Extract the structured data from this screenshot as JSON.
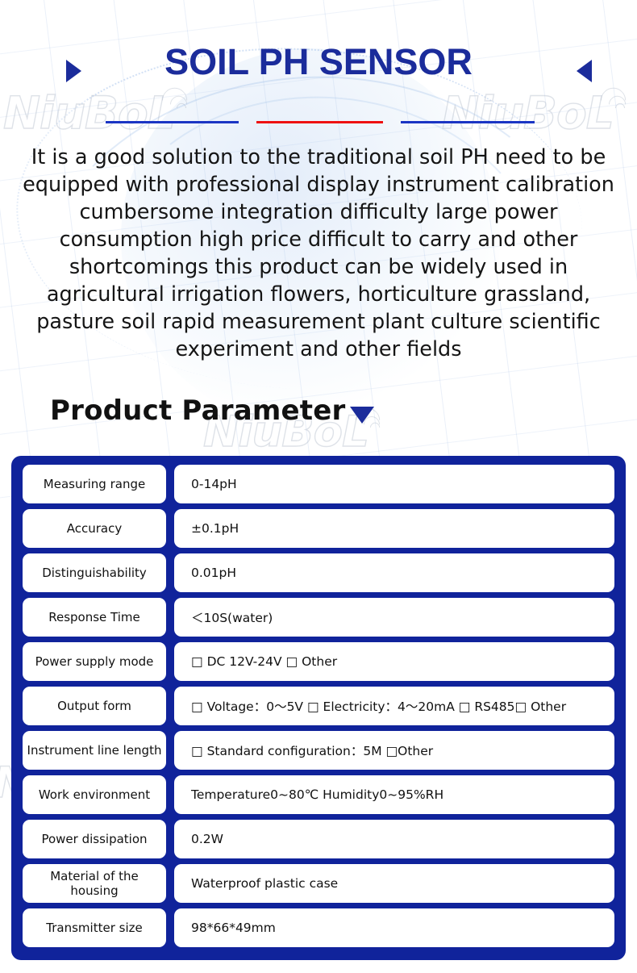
{
  "header": {
    "title": "SOIL PH SENSOR",
    "left_marker_icon": "triangle-right-icon",
    "right_marker_icon": "triangle-left-icon",
    "divider_colors": [
      "#1B35C4",
      "#EE1111",
      "#1B35C4"
    ],
    "title_color": "#1B2C9B"
  },
  "intro": {
    "text": "It is a good solution to the traditional soil PH need to be equipped with professional display instrument calibration cumbersome integration difficulty large power consumption high price difficult to carry and other shortcomings this product can be widely used in agricultural irrigation flowers, horticulture grassland, pasture soil rapid measurement plant culture scientific experiment and other fields"
  },
  "section": {
    "heading": "Product Parameter",
    "marker_icon": "triangle-down-icon"
  },
  "watermark": {
    "text": "NiuBoL",
    "icon": "wifi-signal-icon"
  },
  "spec_table": {
    "panel_color": "#10239B",
    "rows": [
      {
        "label": "Measuring range",
        "value": "0-14pH"
      },
      {
        "label": "Accuracy",
        "value": "±0.1pH"
      },
      {
        "label": "Distinguishability",
        "value": "0.01pH"
      },
      {
        "label": "Response Time",
        "value": "＜10S(water)"
      },
      {
        "label": "Power supply mode",
        "value": "□ DC 12V-24V □ Other"
      },
      {
        "label": "Output form",
        "value": "□ Voltage：0〜5V □ Electricity：4〜20mA □ RS485□ Other"
      },
      {
        "label": "Instrument line length",
        "value": "□ Standard configuration：5M □Other"
      },
      {
        "label": "Work environment",
        "value": "Temperature0~80℃ Humidity0~95%RH"
      },
      {
        "label": "Power dissipation",
        "value": "0.2W"
      },
      {
        "label": "Material of the housing",
        "value": "Waterproof plastic case"
      },
      {
        "label": "Transmitter size",
        "value": "98*66*49mm"
      }
    ]
  }
}
